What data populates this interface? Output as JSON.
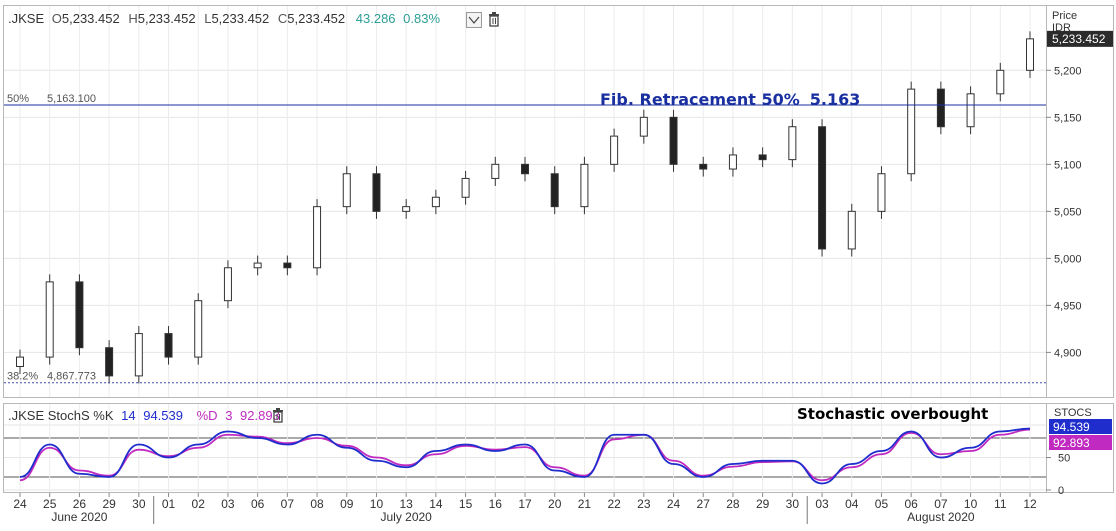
{
  "header": {
    "symbol": ".JKSE",
    "o_label": "O",
    "o_value": "5,233.452",
    "h_label": "H",
    "h_value": "5,233.452",
    "l_label": "L",
    "l_value": "5,233.452",
    "c_label": "C",
    "c_value": "5,233.452",
    "change": "43.286",
    "change_pct": "0.83%",
    "change_color": "#2b9e95"
  },
  "price_axis": {
    "title": "Price",
    "currency": "IDR",
    "last_price": "5,233.452"
  },
  "annotations": {
    "fib50_label": "Fib. Retracement 50%",
    "fib50_value": "5.163",
    "fib50_tag": "50%",
    "fib50_level": "5,163.100",
    "fib382_tag": "38.2%",
    "fib382_level": "4,867.773",
    "stoch_note": "Stochastic overbought"
  },
  "stoch_header": {
    "name": ".JKSE StochS %K",
    "k_period": "14",
    "k_value": "94.539",
    "d_label": "%D",
    "d_period": "3",
    "d_value": "92.893"
  },
  "stoch_axis": {
    "title": "STOCS",
    "k_badge": "94.539",
    "d_badge": "92.893"
  },
  "x_axis": {
    "days": [
      "24",
      "25",
      "26",
      "29",
      "30",
      "01",
      "02",
      "03",
      "06",
      "07",
      "08",
      "09",
      "10",
      "13",
      "14",
      "15",
      "16",
      "17",
      "20",
      "21",
      "22",
      "23",
      "24",
      "27",
      "28",
      "29",
      "30",
      "03",
      "04",
      "05",
      "06",
      "07",
      "10",
      "11",
      "12"
    ],
    "months": [
      "June 2020",
      "July 2020",
      "August 2020"
    ]
  },
  "colors": {
    "fib50": "#1a2fa0",
    "fib382": "#3a4fb0",
    "stoch_k": "#1f2dcc",
    "stoch_d": "#c02ac0",
    "candle_up": "#ffffff",
    "candle_down": "#222222"
  },
  "chart_data": [
    {
      "type": "candlestick",
      "series_name": ".JKSE",
      "unit": "IDR",
      "ylim": [
        4860,
        5245
      ],
      "yticks": [
        4900,
        4950,
        5000,
        5050,
        5100,
        5150,
        5200
      ],
      "grid": true,
      "levels": [
        {
          "name": "Fib. Retracement 50%",
          "value": 5163.1
        },
        {
          "name": "38.2%",
          "value": 4867.773
        }
      ],
      "x": [
        "24",
        "25",
        "26",
        "29",
        "30",
        "01",
        "02",
        "03",
        "06",
        "07",
        "08",
        "09",
        "10",
        "13",
        "14",
        "15",
        "16",
        "17",
        "20",
        "21",
        "22",
        "23",
        "24",
        "27",
        "28",
        "29",
        "30",
        "03",
        "04",
        "05",
        "06",
        "07",
        "10",
        "11",
        "12"
      ],
      "close_approx": [
        4895,
        4975,
        4905,
        4875,
        4920,
        4895,
        4955,
        4990,
        4995,
        4990,
        5055,
        5090,
        5050,
        5055,
        5065,
        5085,
        5100,
        5090,
        5055,
        5100,
        5130,
        5150,
        5100,
        5095,
        5110,
        5105,
        5140,
        5010,
        5050,
        5090,
        5180,
        5140,
        5175,
        5200,
        5233.452
      ]
    },
    {
      "type": "line",
      "title": ".JKSE StochS %K 14 %D 3",
      "ylim": [
        0,
        100
      ],
      "yticks": [
        0,
        50
      ],
      "x": [
        "24",
        "25",
        "26",
        "29",
        "30",
        "01",
        "02",
        "03",
        "06",
        "07",
        "08",
        "09",
        "10",
        "13",
        "14",
        "15",
        "16",
        "17",
        "20",
        "21",
        "22",
        "23",
        "24",
        "27",
        "28",
        "29",
        "30",
        "03",
        "04",
        "05",
        "06",
        "07",
        "10",
        "11",
        "12"
      ],
      "series": [
        {
          "name": "%K",
          "values": [
            20,
            70,
            25,
            20,
            70,
            50,
            70,
            90,
            80,
            70,
            85,
            65,
            45,
            35,
            60,
            70,
            60,
            70,
            30,
            20,
            85,
            85,
            40,
            20,
            40,
            45,
            45,
            10,
            40,
            60,
            90,
            50,
            65,
            90,
            94.539
          ]
        },
        {
          "name": "%D",
          "values": [
            15,
            65,
            30,
            22,
            62,
            52,
            65,
            85,
            82,
            72,
            80,
            68,
            50,
            38,
            55,
            68,
            62,
            66,
            35,
            22,
            78,
            85,
            45,
            22,
            36,
            43,
            44,
            15,
            35,
            55,
            88,
            55,
            60,
            85,
            92.893
          ]
        }
      ]
    }
  ]
}
